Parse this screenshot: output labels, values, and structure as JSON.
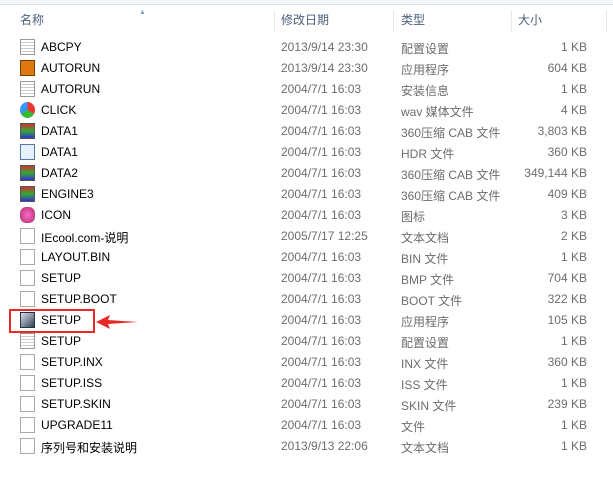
{
  "columns": {
    "name": "名称",
    "date": "修改日期",
    "type": "类型",
    "size": "大小"
  },
  "highlight_color": "#e8292a",
  "files": [
    {
      "name": "ABCPY",
      "date": "2013/9/14 23:30",
      "type": "配置设置",
      "size": "1 KB",
      "icon": "cfg"
    },
    {
      "name": "AUTORUN",
      "date": "2013/9/14 23:30",
      "type": "应用程序",
      "size": "604 KB",
      "icon": "exe"
    },
    {
      "name": "AUTORUN",
      "date": "2004/7/1 16:03",
      "type": "安装信息",
      "size": "1 KB",
      "icon": "cfg"
    },
    {
      "name": "CLICK",
      "date": "2004/7/1 16:03",
      "type": "wav 媒体文件",
      "size": "4 KB",
      "icon": "media"
    },
    {
      "name": "DATA1",
      "date": "2004/7/1 16:03",
      "type": "360压缩 CAB 文件",
      "size": "3,803 KB",
      "icon": "cab"
    },
    {
      "name": "DATA1",
      "date": "2004/7/1 16:03",
      "type": "HDR 文件",
      "size": "360 KB",
      "icon": "hdrf"
    },
    {
      "name": "DATA2",
      "date": "2004/7/1 16:03",
      "type": "360压缩 CAB 文件",
      "size": "349,144 KB",
      "icon": "cab"
    },
    {
      "name": "ENGINE3",
      "date": "2004/7/1 16:03",
      "type": "360压缩 CAB 文件",
      "size": "409 KB",
      "icon": "cab"
    },
    {
      "name": "ICON",
      "date": "2004/7/1 16:03",
      "type": "图标",
      "size": "3 KB",
      "icon": "icon"
    },
    {
      "name": "IEcool.com-说明",
      "date": "2005/7/17 12:25",
      "type": "文本文档",
      "size": "2 KB",
      "icon": "file"
    },
    {
      "name": "LAYOUT.BIN",
      "date": "2004/7/1 16:03",
      "type": "BIN 文件",
      "size": "1 KB",
      "icon": "file"
    },
    {
      "name": "SETUP",
      "date": "2004/7/1 16:03",
      "type": "BMP 文件",
      "size": "704 KB",
      "icon": "file"
    },
    {
      "name": "SETUP.BOOT",
      "date": "2004/7/1 16:03",
      "type": "BOOT 文件",
      "size": "322 KB",
      "icon": "file"
    },
    {
      "name": "SETUP",
      "date": "2004/7/1 16:03",
      "type": "应用程序",
      "size": "105 KB",
      "icon": "setup"
    },
    {
      "name": "SETUP",
      "date": "2004/7/1 16:03",
      "type": "配置设置",
      "size": "1 KB",
      "icon": "cfg"
    },
    {
      "name": "SETUP.INX",
      "date": "2004/7/1 16:03",
      "type": "INX 文件",
      "size": "360 KB",
      "icon": "file"
    },
    {
      "name": "SETUP.ISS",
      "date": "2004/7/1 16:03",
      "type": "ISS 文件",
      "size": "1 KB",
      "icon": "file"
    },
    {
      "name": "SETUP.SKIN",
      "date": "2004/7/1 16:03",
      "type": "SKIN 文件",
      "size": "239 KB",
      "icon": "file"
    },
    {
      "name": "UPGRADE11",
      "date": "2004/7/1 16:03",
      "type": "文件",
      "size": "1 KB",
      "icon": "file"
    },
    {
      "name": "序列号和安装说明",
      "date": "2013/9/13 22:06",
      "type": "文本文档",
      "size": "1 KB",
      "icon": "file"
    }
  ]
}
